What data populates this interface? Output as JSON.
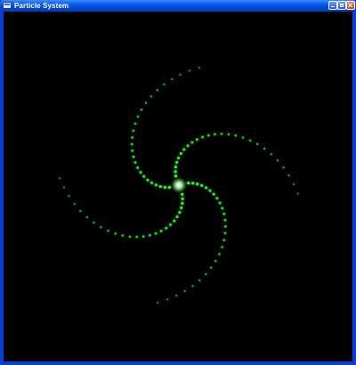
{
  "window": {
    "title": "Particle System",
    "app_icon": "application-window-icon",
    "controls": {
      "minimize_icon": "minimize-icon",
      "maximize_icon": "maximize-icon",
      "close_icon": "close-icon"
    }
  },
  "viewport": {
    "background_color": "#000000",
    "particle_color": "#33ff33",
    "core_color": "#ffffff",
    "arms": 4
  }
}
